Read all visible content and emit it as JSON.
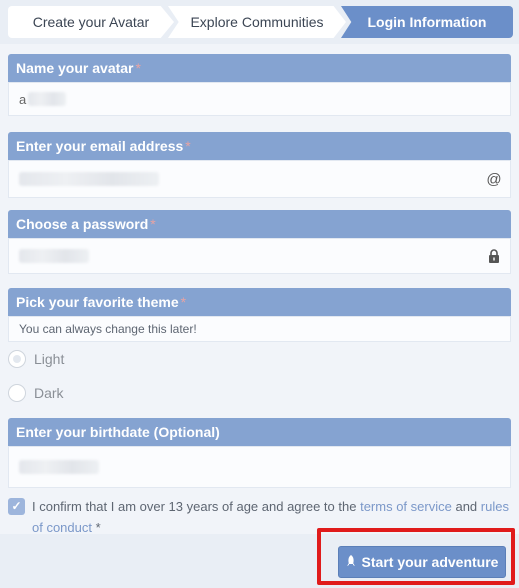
{
  "stepper": {
    "steps": [
      {
        "label": "Create your Avatar"
      },
      {
        "label": "Explore Communities"
      },
      {
        "label": "Login Information"
      }
    ]
  },
  "form": {
    "avatar": {
      "label": "Name your avatar",
      "required": "*",
      "value": "a"
    },
    "email": {
      "label": "Enter your email address",
      "required": "*",
      "icon": "at-icon",
      "icon_glyph": "@"
    },
    "password": {
      "label": "Choose a password",
      "required": "*",
      "icon": "lock-icon"
    },
    "theme": {
      "label": "Pick your favorite theme",
      "required": "*",
      "hint": "You can always change this later!",
      "options": [
        {
          "label": "Light"
        },
        {
          "label": "Dark"
        }
      ]
    },
    "birthdate": {
      "label": "Enter your birthdate (Optional)"
    },
    "confirm": {
      "text_before": "I confirm that I am over 13 years of age and agree to the",
      "terms_link": "terms of service",
      "and": "and",
      "rules_link": "rules of conduct",
      "required": "*"
    }
  },
  "footer": {
    "start_button": "Start your adventure",
    "start_icon": "rocket-icon"
  },
  "colors": {
    "accent": "#6b8fc9",
    "section_header": "#85a3d1",
    "highlight": "#e01b1b"
  }
}
